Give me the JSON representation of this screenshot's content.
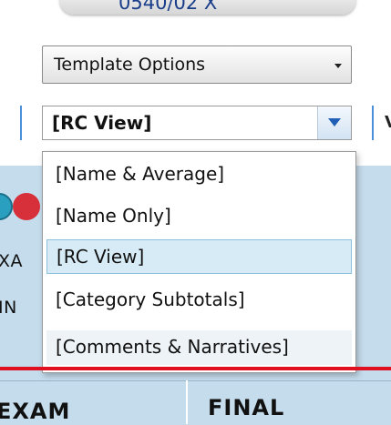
{
  "top_partial": {
    "text": "0540/02 X"
  },
  "template_select": {
    "label": "Template Options"
  },
  "view_combo": {
    "value": "[RC View]",
    "right_stub": "V"
  },
  "dropdown": {
    "items": [
      {
        "label": "[Name & Average]"
      },
      {
        "label": "[Name Only]"
      },
      {
        "label": "[RC View]"
      },
      {
        "label": "[Category Subtotals]"
      },
      {
        "label": "[Comments & Narratives]"
      }
    ],
    "selected_index": 2
  },
  "side_labels": {
    "row1": "XA",
    "row2": "IN"
  },
  "columns": {
    "col1": "EXAM",
    "col2": "FINAL"
  },
  "colors": {
    "accent_blue": "#1f5fb5",
    "band_blue": "#c5dcec",
    "selected_bg": "#d6ebf6",
    "red_line": "#e01020"
  }
}
